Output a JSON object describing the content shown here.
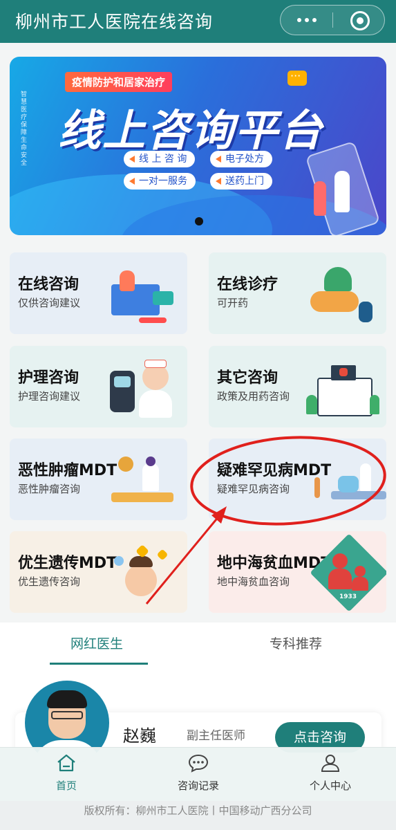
{
  "header": {
    "title": "柳州市工人医院在线咨询",
    "more_icon": "more-dots-icon",
    "close_icon": "mini-program-close-icon"
  },
  "banner": {
    "tag": "疫情防护和居家治疗",
    "side_text": "智慧医疗 保障生命安全",
    "headline": "线上咨询平台",
    "pills": [
      "线 上 咨 询",
      "电子处方",
      "一对一服务",
      "送药上门"
    ]
  },
  "services": [
    {
      "title": "在线咨询",
      "subtitle": "仅供咨询建议",
      "icon": "consultation-illustration"
    },
    {
      "title": "在线诊疗",
      "subtitle": "可开药",
      "icon": "medicine-illustration"
    },
    {
      "title": "护理咨询",
      "subtitle": "护理咨询建议",
      "icon": "nurse-illustration"
    },
    {
      "title": "其它咨询",
      "subtitle": "政策及用药咨询",
      "icon": "hospital-illustration"
    },
    {
      "title": "恶性肿瘤MDT",
      "subtitle": "恶性肿瘤咨询",
      "icon": "lab-illustration"
    },
    {
      "title": "疑难罕见病MDT",
      "subtitle": "疑难罕见病咨询",
      "icon": "ward-illustration"
    },
    {
      "title": "优生遗传MDT",
      "subtitle": "优生遗传咨询",
      "icon": "baby-illustration"
    },
    {
      "title": "地中海贫血MDT",
      "subtitle": "地中海贫血咨询",
      "icon": "family-logo-illustration"
    }
  ],
  "tabs": {
    "active": "网红医生",
    "inactive": "专科推荐"
  },
  "doctor": {
    "name": "赵巍",
    "title": "副主任医师",
    "button": "点击咨询"
  },
  "bottom_nav": [
    {
      "label": "首页",
      "icon": "home-icon"
    },
    {
      "label": "咨询记录",
      "icon": "chat-bubble-icon"
    },
    {
      "label": "个人中心",
      "icon": "user-icon"
    }
  ],
  "footer": "版权所有：柳州市工人医院丨中国移动广西分公司",
  "logo_text": "1933",
  "colors": {
    "primary": "#1f7f7a",
    "annotation": "#e0201c"
  }
}
